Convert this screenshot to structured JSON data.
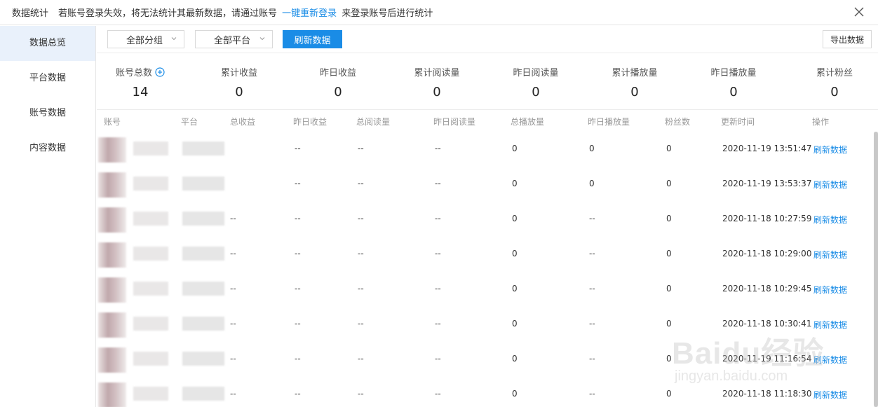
{
  "topbar": {
    "title": "数据统计",
    "notice_prefix": "若账号登录失效，将无法统计其最新数据，请通过账号",
    "notice_link": "一键重新登录",
    "notice_suffix": "来登录账号后进行统计"
  },
  "sidebar": {
    "items": [
      {
        "label": "数据总览"
      },
      {
        "label": "平台数据"
      },
      {
        "label": "账号数据"
      },
      {
        "label": "内容数据"
      }
    ]
  },
  "toolbar": {
    "group_select": "全部分组",
    "platform_select": "全部平台",
    "refresh_label": "刷新数据",
    "export_label": "导出数据"
  },
  "stats": [
    {
      "label": "账号总数",
      "value": "14"
    },
    {
      "label": "累计收益",
      "value": "0"
    },
    {
      "label": "昨日收益",
      "value": "0"
    },
    {
      "label": "累计阅读量",
      "value": "0"
    },
    {
      "label": "昨日阅读量",
      "value": "0"
    },
    {
      "label": "累计播放量",
      "value": "0"
    },
    {
      "label": "昨日播放量",
      "value": "0"
    },
    {
      "label": "累计粉丝",
      "value": "0"
    }
  ],
  "table": {
    "headers": [
      "账号",
      "平台",
      "总收益",
      "昨日收益",
      "总阅读量",
      "昨日阅读量",
      "总播放量",
      "昨日播放量",
      "粉丝数",
      "更新时间",
      "操作"
    ],
    "rows": [
      {
        "total_income": "",
        "yesterday_income": "--",
        "total_reads": "--",
        "yesterday_reads": "--",
        "total_plays": "0",
        "yesterday_plays": "0",
        "fans": "0",
        "updated": "2020-11-19 13:51:47",
        "action": "刷新数据"
      },
      {
        "total_income": "",
        "yesterday_income": "--",
        "total_reads": "--",
        "yesterday_reads": "--",
        "total_plays": "0",
        "yesterday_plays": "0",
        "fans": "0",
        "updated": "2020-11-19 13:53:37",
        "action": "刷新数据"
      },
      {
        "total_income": "--",
        "yesterday_income": "--",
        "total_reads": "--",
        "yesterday_reads": "--",
        "total_plays": "0",
        "yesterday_plays": "--",
        "fans": "0",
        "updated": "2020-11-18 10:27:59",
        "action": "刷新数据"
      },
      {
        "total_income": "--",
        "yesterday_income": "--",
        "total_reads": "--",
        "yesterday_reads": "--",
        "total_plays": "0",
        "yesterday_plays": "--",
        "fans": "0",
        "updated": "2020-11-18 10:29:00",
        "action": "刷新数据"
      },
      {
        "total_income": "--",
        "yesterday_income": "--",
        "total_reads": "--",
        "yesterday_reads": "--",
        "total_plays": "0",
        "yesterday_plays": "--",
        "fans": "0",
        "updated": "2020-11-18 10:29:45",
        "action": "刷新数据"
      },
      {
        "total_income": "--",
        "yesterday_income": "--",
        "total_reads": "--",
        "yesterday_reads": "--",
        "total_plays": "0",
        "yesterday_plays": "--",
        "fans": "0",
        "updated": "2020-11-18 10:30:41",
        "action": "刷新数据"
      },
      {
        "total_income": "--",
        "yesterday_income": "--",
        "total_reads": "--",
        "yesterday_reads": "--",
        "total_plays": "0",
        "yesterday_plays": "--",
        "fans": "0",
        "updated": "2020-11-19 11:16:54",
        "action": "刷新数据"
      },
      {
        "total_income": "--",
        "yesterday_income": "--",
        "total_reads": "--",
        "yesterday_reads": "--",
        "total_plays": "0",
        "yesterday_plays": "--",
        "fans": "0",
        "updated": "2020-11-18 11:18:30",
        "action": "刷新数据"
      }
    ]
  },
  "watermark": {
    "main": "Baidu经验",
    "sub": "jingyan.baidu.com"
  },
  "colors": {
    "accent": "#1a8ce6",
    "active_nav": "#e9f1fb"
  }
}
